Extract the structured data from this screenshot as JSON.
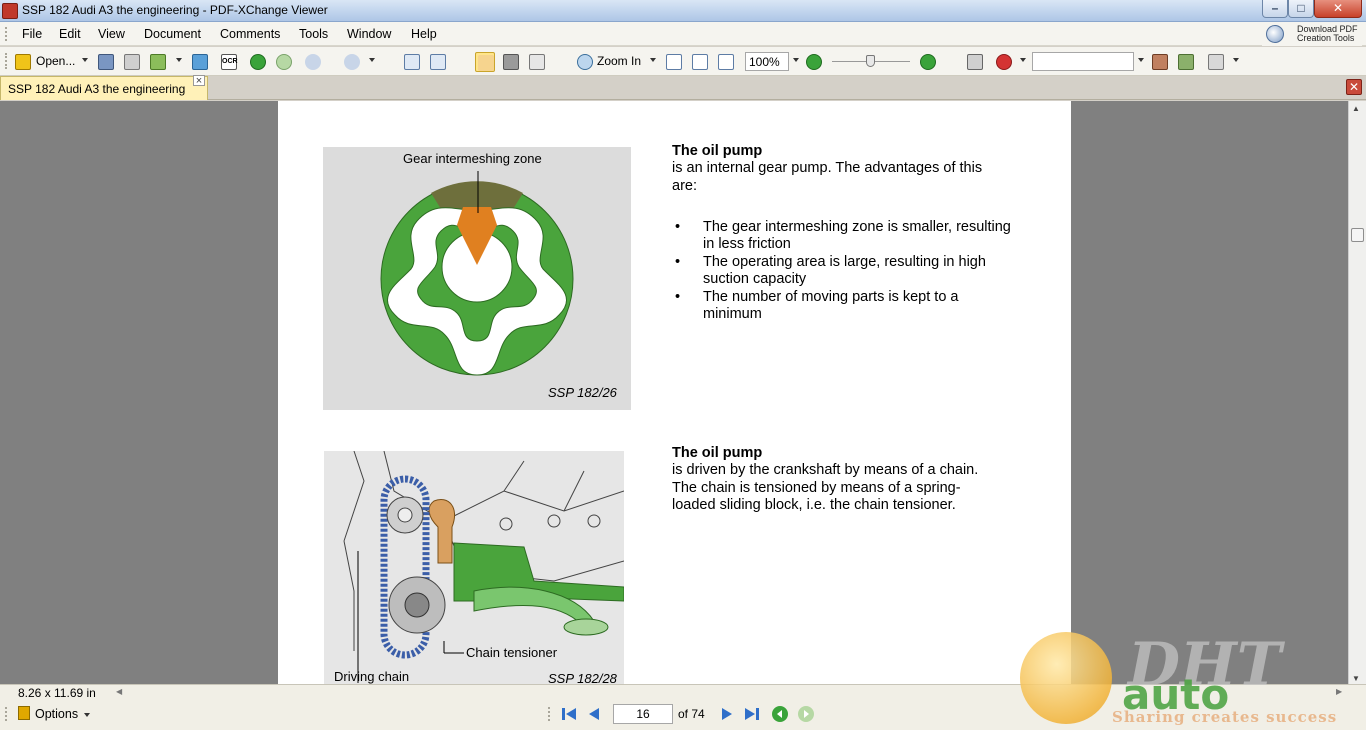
{
  "window": {
    "title": "SSP 182   Audi A3 the engineering - PDF-XChange Viewer"
  },
  "titlebar_buttons": {
    "minimize": "–",
    "maximize": "□",
    "close": "✕"
  },
  "menu": [
    {
      "label": "File"
    },
    {
      "label": "Edit"
    },
    {
      "label": "View"
    },
    {
      "label": "Document"
    },
    {
      "label": "Comments"
    },
    {
      "label": "Tools"
    },
    {
      "label": "Window"
    },
    {
      "label": "Help"
    }
  ],
  "download_tools": {
    "line1": "Download PDF",
    "line2": "Creation Tools"
  },
  "toolbar": {
    "open_label": "Open...",
    "zoom_in_label": "Zoom In",
    "zoom_value": "100%",
    "ocr_label": "OCR",
    "search_value": ""
  },
  "tab": {
    "label": "SSP 182   Audi A3 the engineering",
    "close": "×"
  },
  "document": {
    "figure1": {
      "caption": "Gear intermeshing zone",
      "ref": "SSP 182/26"
    },
    "section1": {
      "heading": "The oil pump",
      "intro": "is an internal gear pump. The advantages of this are:",
      "bullets": [
        "The gear intermeshing zone is smaller, resulting in less friction",
        "The operating area is large, resulting in high suction capacity",
        "The number of moving parts is kept to a minimum"
      ]
    },
    "figure2": {
      "label_tensioner": "Chain tensioner",
      "label_chain": "Driving chain",
      "ref": "SSP 182/28"
    },
    "section2": {
      "heading": "The oil pump",
      "body": "is driven by the crankshaft by means of a chain. The chain is tensioned by means of a spring-loaded sliding block, i.e. the chain tensioner."
    }
  },
  "status": {
    "page_size": "8.26 x 11.69 in",
    "options_label": "Options",
    "current_page": "16",
    "page_count": "of 74"
  },
  "watermark": {
    "brand": "DHT",
    "brand2": "auto",
    "tagline": "Sharing creates success"
  },
  "colors": {
    "pump_green": "#4aa43c",
    "zone_orange": "#e08020",
    "tab_yellow": "#fff1b8",
    "viewer_gray": "#808080"
  }
}
